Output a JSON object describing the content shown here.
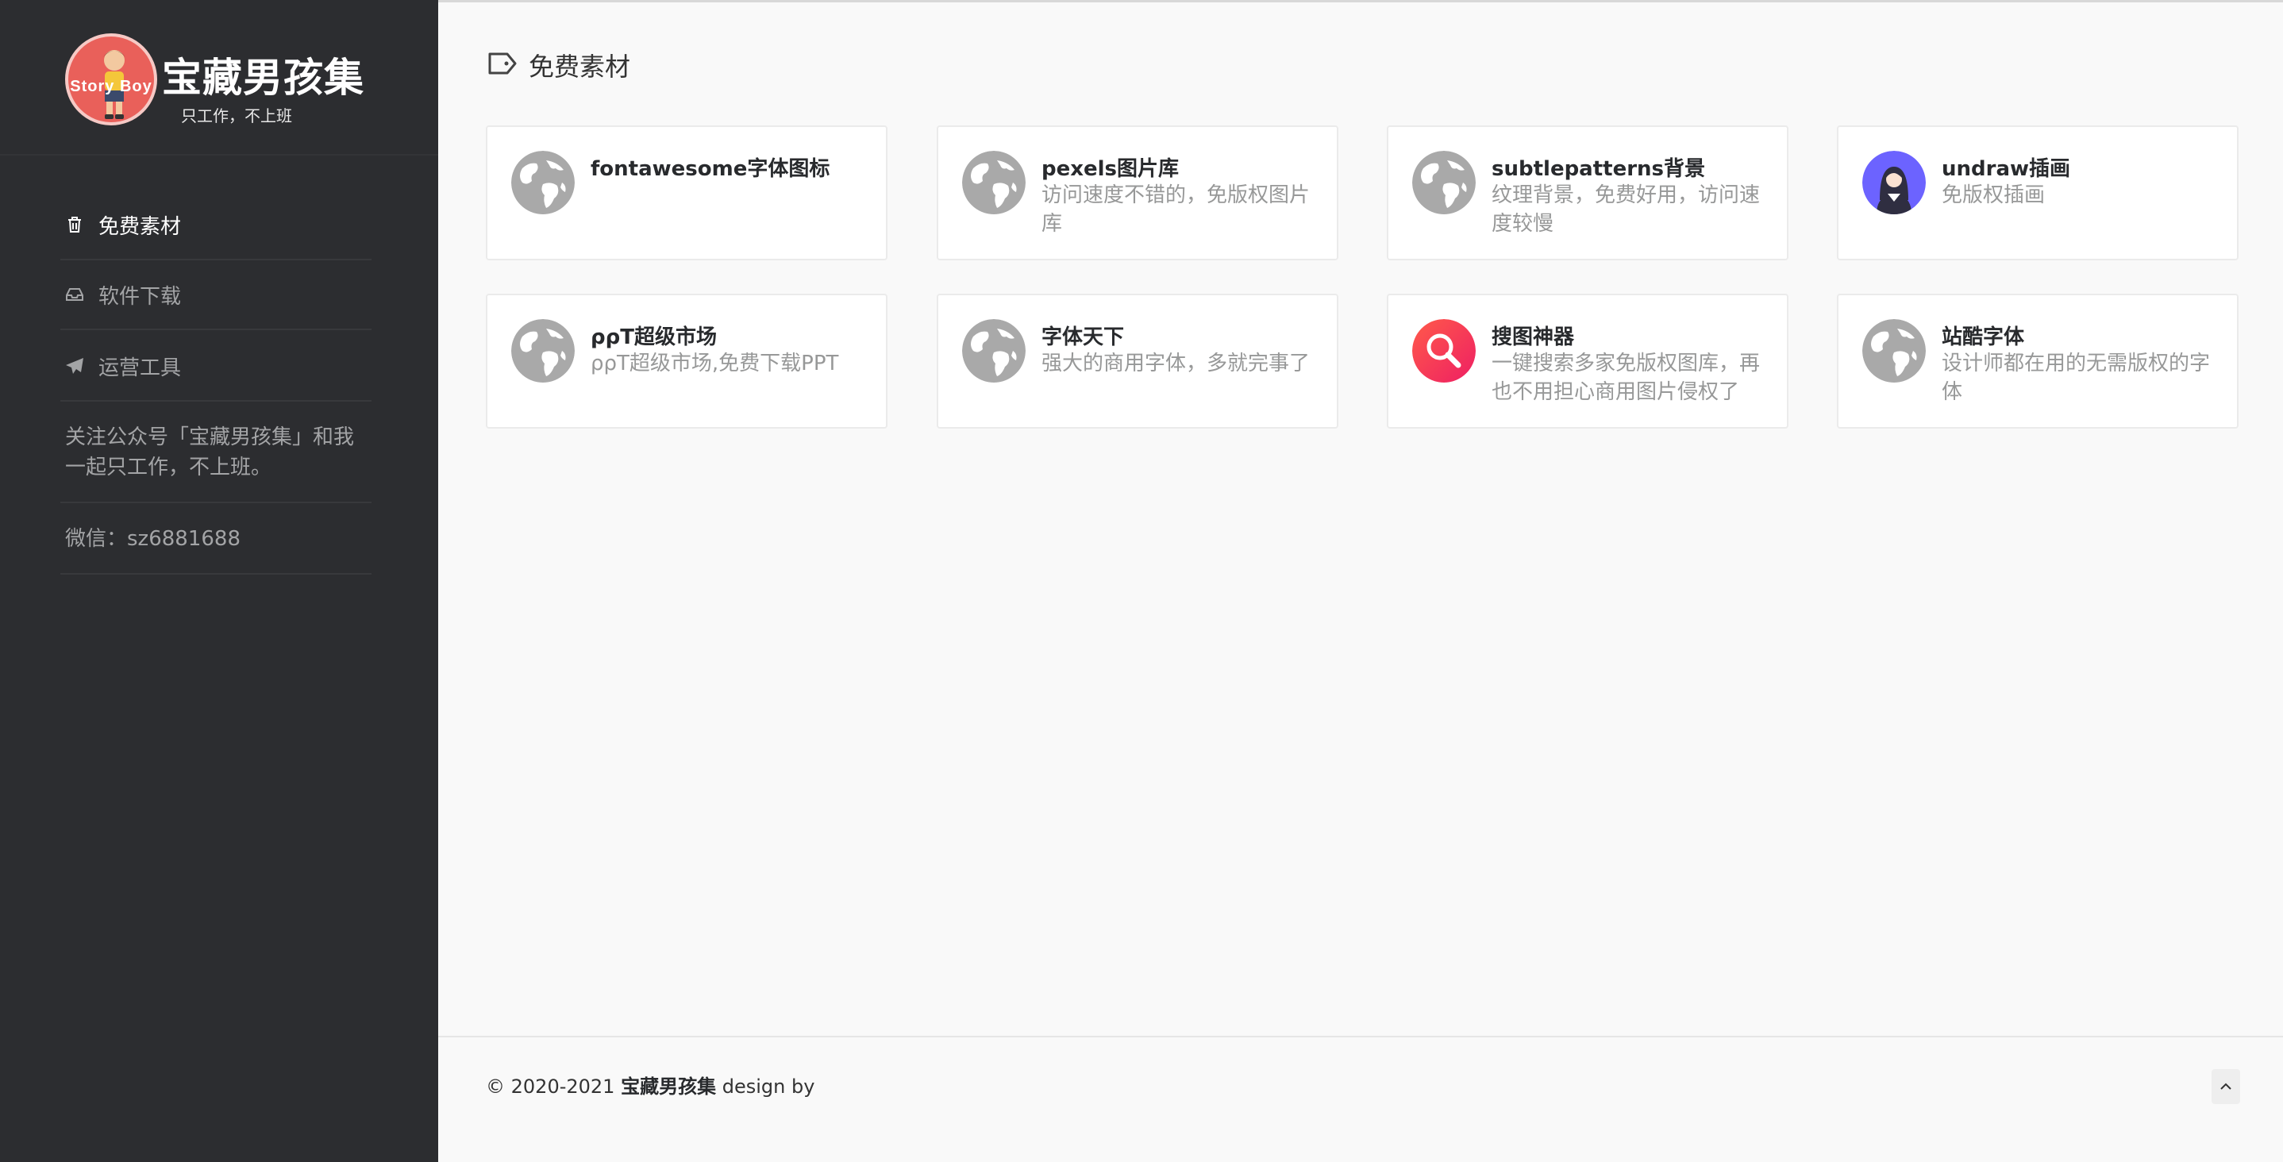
{
  "brand": {
    "title": "宝藏男孩集",
    "subtitle": "只工作，不上班",
    "logo_text": "Story Boy"
  },
  "sidebar": {
    "items": [
      {
        "label": "免费素材",
        "icon": "trash-icon",
        "active": true
      },
      {
        "label": "软件下载",
        "icon": "inbox-icon",
        "active": false
      },
      {
        "label": "运营工具",
        "icon": "paper-plane-icon",
        "active": false
      }
    ],
    "follow_text": "关注公众号「宝藏男孩集」和我一起只工作，不上班。",
    "wechat_text": "微信：sz6881688"
  },
  "main": {
    "section_title": "免费素材",
    "section_icon": "tag-icon",
    "cards": [
      {
        "title": "fontawesome字体图标",
        "desc": "",
        "icon": "globe-icon"
      },
      {
        "title": "pexels图片库",
        "desc": "访问速度不错的，免版权图片库",
        "icon": "globe-icon"
      },
      {
        "title": "subtlepatterns背景",
        "desc": "纹理背景，免费好用，访问速度较慢",
        "icon": "globe-icon"
      },
      {
        "title": "undraw插画",
        "desc": "免版权插画",
        "icon": "person-avatar-icon"
      },
      {
        "title": "ρρT超级市场",
        "desc": "ρρT超级市场,免费下载PPT",
        "icon": "globe-icon"
      },
      {
        "title": "字体天下",
        "desc": "强大的商用字体，多就完事了",
        "icon": "globe-icon"
      },
      {
        "title": "搜图神器",
        "desc": "一键搜索多家免版权图库，再也不用担心商用图片侵权了",
        "icon": "magnifier-icon"
      },
      {
        "title": "站酷字体",
        "desc": "设计师都在用的无需版权的字体",
        "icon": "globe-icon"
      }
    ]
  },
  "footer": {
    "copyright": "© 2020-2021",
    "site_name": "宝藏男孩集",
    "design_by": "design by"
  },
  "colors": {
    "sidebar_bg": "#2c2d30",
    "page_bg": "#f9f9f9",
    "logo_red": "#e9605a",
    "undraw_purple": "#6c63ff",
    "search_red": "#f2335a"
  }
}
